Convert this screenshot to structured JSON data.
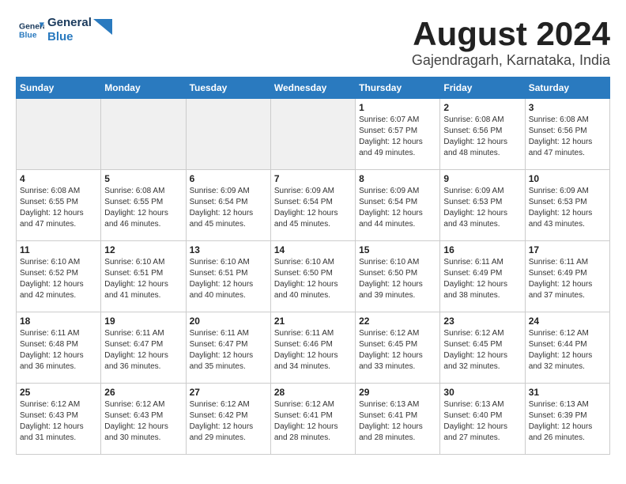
{
  "header": {
    "logo_line1": "General",
    "logo_line2": "Blue",
    "month": "August 2024",
    "location": "Gajendragarh, Karnataka, India"
  },
  "weekdays": [
    "Sunday",
    "Monday",
    "Tuesday",
    "Wednesday",
    "Thursday",
    "Friday",
    "Saturday"
  ],
  "weeks": [
    [
      {
        "day": "",
        "empty": true
      },
      {
        "day": "",
        "empty": true
      },
      {
        "day": "",
        "empty": true
      },
      {
        "day": "",
        "empty": true
      },
      {
        "day": "1",
        "sunrise": "6:07 AM",
        "sunset": "6:57 PM",
        "daylight": "12 hours and 49 minutes."
      },
      {
        "day": "2",
        "sunrise": "6:08 AM",
        "sunset": "6:56 PM",
        "daylight": "12 hours and 48 minutes."
      },
      {
        "day": "3",
        "sunrise": "6:08 AM",
        "sunset": "6:56 PM",
        "daylight": "12 hours and 47 minutes."
      }
    ],
    [
      {
        "day": "4",
        "sunrise": "6:08 AM",
        "sunset": "6:55 PM",
        "daylight": "12 hours and 47 minutes."
      },
      {
        "day": "5",
        "sunrise": "6:08 AM",
        "sunset": "6:55 PM",
        "daylight": "12 hours and 46 minutes."
      },
      {
        "day": "6",
        "sunrise": "6:09 AM",
        "sunset": "6:54 PM",
        "daylight": "12 hours and 45 minutes."
      },
      {
        "day": "7",
        "sunrise": "6:09 AM",
        "sunset": "6:54 PM",
        "daylight": "12 hours and 45 minutes."
      },
      {
        "day": "8",
        "sunrise": "6:09 AM",
        "sunset": "6:54 PM",
        "daylight": "12 hours and 44 minutes."
      },
      {
        "day": "9",
        "sunrise": "6:09 AM",
        "sunset": "6:53 PM",
        "daylight": "12 hours and 43 minutes."
      },
      {
        "day": "10",
        "sunrise": "6:09 AM",
        "sunset": "6:53 PM",
        "daylight": "12 hours and 43 minutes."
      }
    ],
    [
      {
        "day": "11",
        "sunrise": "6:10 AM",
        "sunset": "6:52 PM",
        "daylight": "12 hours and 42 minutes."
      },
      {
        "day": "12",
        "sunrise": "6:10 AM",
        "sunset": "6:51 PM",
        "daylight": "12 hours and 41 minutes."
      },
      {
        "day": "13",
        "sunrise": "6:10 AM",
        "sunset": "6:51 PM",
        "daylight": "12 hours and 40 minutes."
      },
      {
        "day": "14",
        "sunrise": "6:10 AM",
        "sunset": "6:50 PM",
        "daylight": "12 hours and 40 minutes."
      },
      {
        "day": "15",
        "sunrise": "6:10 AM",
        "sunset": "6:50 PM",
        "daylight": "12 hours and 39 minutes."
      },
      {
        "day": "16",
        "sunrise": "6:11 AM",
        "sunset": "6:49 PM",
        "daylight": "12 hours and 38 minutes."
      },
      {
        "day": "17",
        "sunrise": "6:11 AM",
        "sunset": "6:49 PM",
        "daylight": "12 hours and 37 minutes."
      }
    ],
    [
      {
        "day": "18",
        "sunrise": "6:11 AM",
        "sunset": "6:48 PM",
        "daylight": "12 hours and 36 minutes."
      },
      {
        "day": "19",
        "sunrise": "6:11 AM",
        "sunset": "6:47 PM",
        "daylight": "12 hours and 36 minutes."
      },
      {
        "day": "20",
        "sunrise": "6:11 AM",
        "sunset": "6:47 PM",
        "daylight": "12 hours and 35 minutes."
      },
      {
        "day": "21",
        "sunrise": "6:11 AM",
        "sunset": "6:46 PM",
        "daylight": "12 hours and 34 minutes."
      },
      {
        "day": "22",
        "sunrise": "6:12 AM",
        "sunset": "6:45 PM",
        "daylight": "12 hours and 33 minutes."
      },
      {
        "day": "23",
        "sunrise": "6:12 AM",
        "sunset": "6:45 PM",
        "daylight": "12 hours and 32 minutes."
      },
      {
        "day": "24",
        "sunrise": "6:12 AM",
        "sunset": "6:44 PM",
        "daylight": "12 hours and 32 minutes."
      }
    ],
    [
      {
        "day": "25",
        "sunrise": "6:12 AM",
        "sunset": "6:43 PM",
        "daylight": "12 hours and 31 minutes."
      },
      {
        "day": "26",
        "sunrise": "6:12 AM",
        "sunset": "6:43 PM",
        "daylight": "12 hours and 30 minutes."
      },
      {
        "day": "27",
        "sunrise": "6:12 AM",
        "sunset": "6:42 PM",
        "daylight": "12 hours and 29 minutes."
      },
      {
        "day": "28",
        "sunrise": "6:12 AM",
        "sunset": "6:41 PM",
        "daylight": "12 hours and 28 minutes."
      },
      {
        "day": "29",
        "sunrise": "6:13 AM",
        "sunset": "6:41 PM",
        "daylight": "12 hours and 28 minutes."
      },
      {
        "day": "30",
        "sunrise": "6:13 AM",
        "sunset": "6:40 PM",
        "daylight": "12 hours and 27 minutes."
      },
      {
        "day": "31",
        "sunrise": "6:13 AM",
        "sunset": "6:39 PM",
        "daylight": "12 hours and 26 minutes."
      }
    ]
  ]
}
